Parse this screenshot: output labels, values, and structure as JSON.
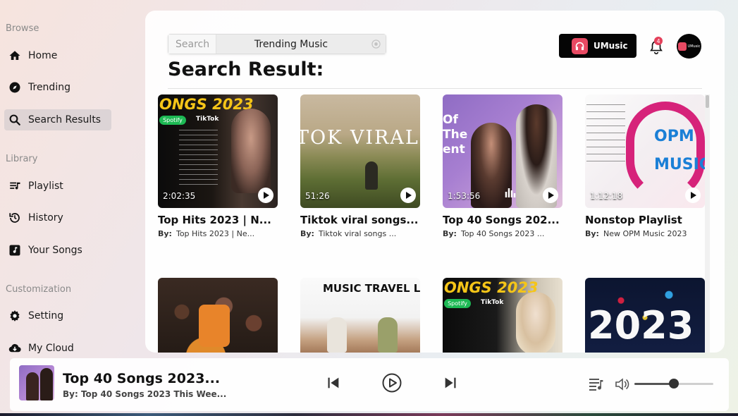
{
  "sidebar": {
    "browse_title": "Browse",
    "library_title": "Library",
    "custom_title": "Customization",
    "items": [
      {
        "label": "Home",
        "icon": "home-icon"
      },
      {
        "label": "Trending",
        "icon": "compass-icon"
      },
      {
        "label": "Search Results",
        "icon": "search-icon"
      },
      {
        "label": "Playlist",
        "icon": "playlist-icon"
      },
      {
        "label": "History",
        "icon": "history-icon"
      },
      {
        "label": "Your Songs",
        "icon": "music-note-icon"
      },
      {
        "label": "Setting",
        "icon": "gear-icon"
      },
      {
        "label": "My Cloud",
        "icon": "cloud-icon"
      }
    ],
    "active_item": "Search Results"
  },
  "search": {
    "label": "Search",
    "value": "Trending Music"
  },
  "page_title": "Search Result:",
  "brand": {
    "name": "UMusic",
    "avatar_text": "UMusic"
  },
  "notifications": {
    "count": "4"
  },
  "results": [
    {
      "title": "Top Hits 2023 | N...",
      "by_label": "By:",
      "artist": "Top Hits 2023 | Ne...",
      "duration": "2:02:35",
      "thumb_text": "ONGS 2023",
      "badges": [
        "Spotify",
        "TikTok"
      ]
    },
    {
      "title": "Tiktok viral songs...",
      "by_label": "By:",
      "artist": "Tiktok viral songs ...",
      "duration": "51:26",
      "thumb_text": "TOK VIRAL SO"
    },
    {
      "title": "Top 40 Songs 202...",
      "by_label": "By:",
      "artist": "Top 40 Songs 2023 ...",
      "duration": "1:53:56",
      "thumb_text": "Of The ent"
    },
    {
      "title": "Nonstop Playlist",
      "by_label": "By:",
      "artist": "New OPM Music 2023",
      "duration": "1:12:18",
      "thumb_text": "OPM MUSIC"
    },
    {
      "title": "",
      "artist": "",
      "duration": ""
    },
    {
      "title": "",
      "artist": "",
      "duration": "",
      "thumb_text": "MUSIC TRAVEL LOVE"
    },
    {
      "title": "",
      "artist": "",
      "duration": "",
      "thumb_text": "ONGS 2023",
      "badges": [
        "Spotify",
        "TikTok"
      ]
    },
    {
      "title": "",
      "artist": "",
      "duration": "",
      "thumb_text": "2023"
    }
  ],
  "player": {
    "title": "Top 40 Songs 2023...",
    "subtitle": "By: Top 40 Songs 2023 This Wee...",
    "volume_percent": 50
  },
  "colors": {
    "accent": "#e84a63",
    "brand_bg": "#050505"
  }
}
